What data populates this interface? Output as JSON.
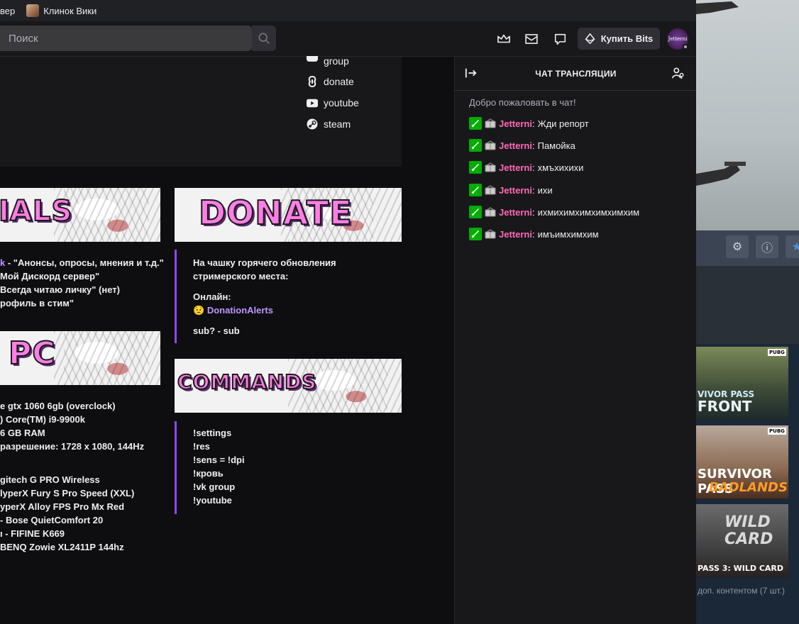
{
  "browser": {
    "prev_tab_fragment": "вер",
    "tab_title": "Клинок Вики"
  },
  "topnav": {
    "search_placeholder": "Поиск",
    "bits_label": "Купить Bits",
    "avatar_text": "Jetterni"
  },
  "socials": {
    "links": [
      {
        "label": "group",
        "icon": "vk-icon"
      },
      {
        "label": "donate",
        "icon": "donationalerts-icon"
      },
      {
        "label": "youtube",
        "icon": "youtube-icon"
      },
      {
        "label": "steam",
        "icon": "steam-icon"
      }
    ]
  },
  "panels": {
    "socials_banner": "IALS",
    "socials_lines": [
      {
        "prefix": "k",
        "text": " - \"Анонсы, опросы, мнения и т.д.\""
      },
      {
        "prefix": "",
        "text": "Мой Дискорд сервер\""
      },
      {
        "prefix": "",
        "text": "Всегда читаю личку\" (нет)"
      },
      {
        "prefix": "",
        "text": "рофиль в стим\""
      }
    ],
    "pc_banner": "PC",
    "pc_lines": [
      "e gtx 1060 6gb (overclock)",
      ") Core(TM) i9-9900k",
      "6 GB RAM",
      "разрешение: 1728 x 1080, 144Hz",
      "",
      "gitech G PRO Wireless",
      "lyperX Fury S Pro Speed (XXL)",
      "yperX Alloy FPS Pro Mx Red",
      "- Bose QuietComfort 20",
      "ı - FIFINE K669",
      "BENQ Zowie XL2411P 144hz"
    ],
    "donate_banner": "DONATE",
    "donate_line1": "На чашку горячего обновления",
    "donate_line2": "стримерского места:",
    "donate_online": "Онлайн:",
    "donate_link": "DonationAlerts",
    "donate_sub": "sub? - sub",
    "commands_banner": "COMMANDS",
    "commands": [
      "!settings",
      "!res",
      "!sens = !dpi",
      "!кровь",
      "!vk group",
      "!youtube"
    ]
  },
  "chat": {
    "title": "ЧАТ ТРАНСЛЯЦИИ",
    "welcome": "Добро пожаловать в чат!",
    "messages": [
      {
        "user": "Jetterni",
        "text": "Жди репорт"
      },
      {
        "user": "Jetterni",
        "text": "Памойка"
      },
      {
        "user": "Jetterni",
        "text": "хмъхихихи"
      },
      {
        "user": "Jetterni",
        "text": "ихи"
      },
      {
        "user": "Jetterni",
        "text": "ихмихимхимхимхимхим"
      },
      {
        "user": "Jetterni",
        "text": "имъимхимхим"
      }
    ]
  },
  "steam": {
    "thumb1_caption": "VIVOR PASS",
    "thumb1_caption2": "FRONT",
    "thumb2_caption": "SURVIVOR PASS",
    "thumb2_caption2": "BADLANDS",
    "thumb3_caption": "WILD CARD",
    "thumb3_caption2": "PASS 3: WILD CARD",
    "badge": "PUBG",
    "footer": "доп. контентом (7 шт.)"
  },
  "colors": {
    "accent": "#9147ff",
    "username": "#ff69b4",
    "sword_badge": "#00ad03",
    "link": "#bf94ff"
  }
}
